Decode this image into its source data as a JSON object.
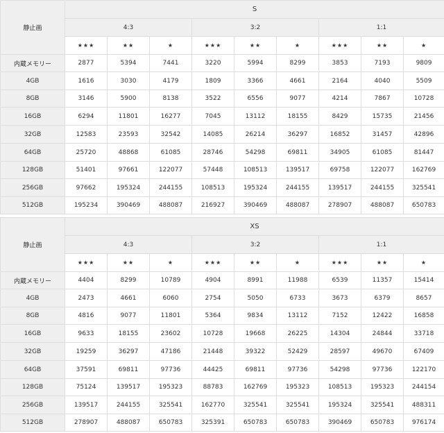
{
  "tables": [
    {
      "size": "S",
      "corner": "静止画",
      "ratios": [
        "4:3",
        "3:2",
        "1:1"
      ],
      "quality": [
        "★★★",
        "★★",
        "★",
        "★★★",
        "★★",
        "★",
        "★★★",
        "★★",
        "★"
      ],
      "rows": [
        {
          "label": "内蔵メモリー",
          "values": [
            "2877",
            "5394",
            "7441",
            "3220",
            "5994",
            "8299",
            "3853",
            "7193",
            "9809"
          ]
        },
        {
          "label": "4GB",
          "values": [
            "1616",
            "3030",
            "4179",
            "1809",
            "3366",
            "4661",
            "2164",
            "4040",
            "5509"
          ]
        },
        {
          "label": "8GB",
          "values": [
            "3146",
            "5900",
            "8138",
            "3522",
            "6556",
            "9077",
            "4214",
            "7867",
            "10728"
          ]
        },
        {
          "label": "16GB",
          "values": [
            "6294",
            "11801",
            "16277",
            "7045",
            "13112",
            "18155",
            "8429",
            "15735",
            "21456"
          ]
        },
        {
          "label": "32GB",
          "values": [
            "12583",
            "23593",
            "32542",
            "14085",
            "26214",
            "36297",
            "16852",
            "31457",
            "42896"
          ]
        },
        {
          "label": "64GB",
          "values": [
            "25720",
            "48868",
            "61085",
            "28746",
            "54298",
            "69811",
            "34905",
            "61085",
            "81447"
          ]
        },
        {
          "label": "128GB",
          "values": [
            "51401",
            "97661",
            "122077",
            "57448",
            "108513",
            "139517",
            "69758",
            "122077",
            "162769"
          ]
        },
        {
          "label": "256GB",
          "values": [
            "97662",
            "195324",
            "244155",
            "108513",
            "195324",
            "244155",
            "139517",
            "244155",
            "325541"
          ]
        },
        {
          "label": "512GB",
          "values": [
            "195234",
            "390469",
            "488087",
            "216927",
            "390469",
            "488087",
            "278907",
            "488087",
            "650783"
          ]
        }
      ]
    },
    {
      "size": "XS",
      "corner": "静止画",
      "ratios": [
        "4:3",
        "3:2",
        "1:1"
      ],
      "quality": [
        "★★★",
        "★★",
        "★",
        "★★★",
        "★★",
        "★",
        "★★★",
        "★★",
        "★"
      ],
      "rows": [
        {
          "label": "内蔵メモリー",
          "values": [
            "4404",
            "8299",
            "10789",
            "4904",
            "8991",
            "11988",
            "6539",
            "11357",
            "15414"
          ]
        },
        {
          "label": "4GB",
          "values": [
            "2473",
            "4661",
            "6060",
            "2754",
            "5050",
            "6733",
            "3673",
            "6379",
            "8657"
          ]
        },
        {
          "label": "8GB",
          "values": [
            "4816",
            "9077",
            "11801",
            "5364",
            "9834",
            "13112",
            "7152",
            "12422",
            "16858"
          ]
        },
        {
          "label": "16GB",
          "values": [
            "9633",
            "18155",
            "23602",
            "10728",
            "19668",
            "26225",
            "14304",
            "24844",
            "33718"
          ]
        },
        {
          "label": "32GB",
          "values": [
            "19259",
            "36297",
            "47186",
            "21448",
            "39322",
            "52429",
            "28597",
            "49670",
            "67409"
          ]
        },
        {
          "label": "64GB",
          "values": [
            "37591",
            "69811",
            "97736",
            "44425",
            "69811",
            "97736",
            "54298",
            "97736",
            "122170"
          ]
        },
        {
          "label": "128GB",
          "values": [
            "75124",
            "139517",
            "195323",
            "88783",
            "162769",
            "195323",
            "108513",
            "195323",
            "244154"
          ]
        },
        {
          "label": "256GB",
          "values": [
            "139517",
            "244155",
            "325541",
            "162770",
            "325541",
            "325541",
            "195324",
            "325541",
            "488311"
          ]
        },
        {
          "label": "512GB",
          "values": [
            "278907",
            "488087",
            "650783",
            "325391",
            "650783",
            "650783",
            "390469",
            "650783",
            "976174"
          ]
        }
      ]
    }
  ]
}
